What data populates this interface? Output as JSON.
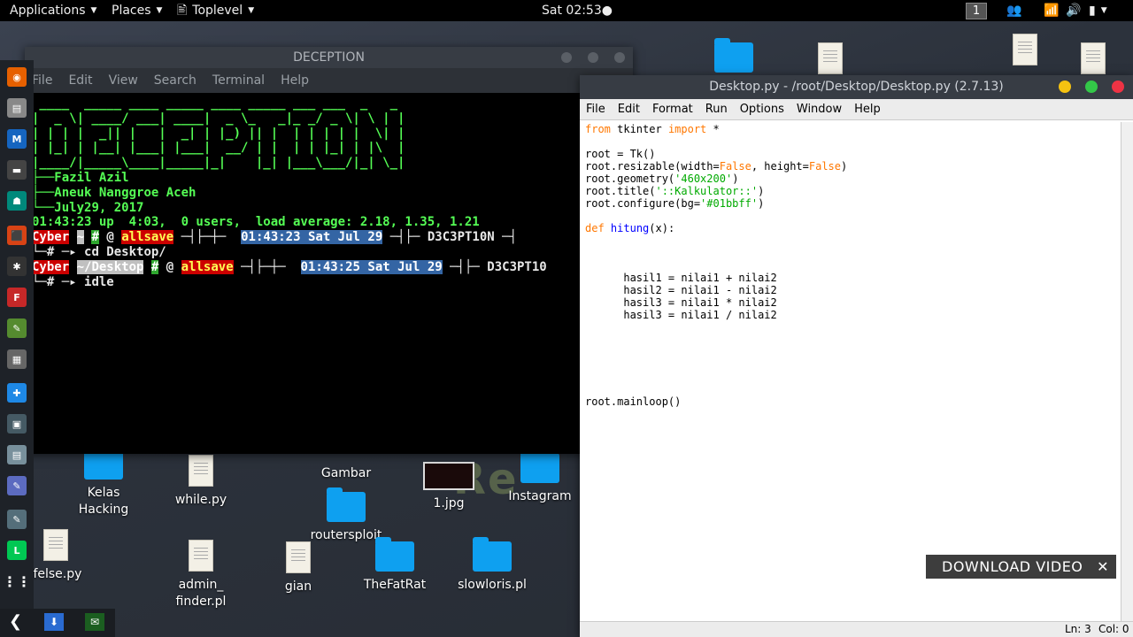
{
  "topbar": {
    "applications": "Applications",
    "places": "Places",
    "toplevel": "Toplevel",
    "clock": "Sat 02:53●",
    "workspace": "1"
  },
  "desktop": {
    "bg_text": "Re",
    "icons": [
      {
        "label": "Kelas Hacking",
        "type": "folder"
      },
      {
        "label": "while.py",
        "type": "file"
      },
      {
        "label": "Gambar",
        "type": "folder"
      },
      {
        "label": "1.jpg",
        "type": "image"
      },
      {
        "label": "Instagram",
        "type": "folder"
      },
      {
        "label": "routersploit",
        "type": "folder"
      },
      {
        "label": "ifelse.py",
        "type": "file"
      },
      {
        "label": "admin_\nfinder.pl",
        "type": "file"
      },
      {
        "label": "gian",
        "type": "file"
      },
      {
        "label": "TheFatRat",
        "type": "folder"
      },
      {
        "label": "slowloris.pl",
        "type": "folder"
      }
    ]
  },
  "terminal": {
    "title": "DECEPTION",
    "menu": [
      "File",
      "Edit",
      "View",
      "Search",
      "Terminal",
      "Help"
    ],
    "banner": [
      " ____  _____ ____ _____ ____ _____ ___ ___  _   _ ",
      "|  _ \\| ____/ ___| ____|  _ \\_   _|_ _/ _ \\| \\ | |",
      "| | | |  _|| |   |  _| | |_) || |  | | | | |  \\| |",
      "| |_| | |__| |___| |___|  __/ | |  | | |_| | |\\  |",
      "|____/|_____\\____|_____|_|    |_| |___\\___/|_| \\_|"
    ],
    "info_1": "Fazil Azil",
    "info_2": "Aneuk Nanggroe Aceh",
    "info_3": "July29, 2017",
    "uptime": "01:43:23 up  4:03,  0 users,  load average: 2.18, 1.35, 1.21",
    "prompt1": {
      "user": "Cyber",
      "dir": "~",
      "hash": "#",
      "at": "@",
      "host": "allsave",
      "time": "01:43:23 Sat Jul 29",
      "tag": "D3C3PT10N",
      "cmd": "cd Desktop/"
    },
    "prompt2": {
      "user": "Cyber",
      "dir": "~/Desktop",
      "hash": "#",
      "at": "@",
      "host": "allsave",
      "time": "01:43:25 Sat Jul 29",
      "tag": "D3C3PT10",
      "cmd": "idle"
    }
  },
  "idle": {
    "title": "Desktop.py - /root/Desktop/Desktop.py (2.7.13)",
    "menu": [
      "File",
      "Edit",
      "Format",
      "Run",
      "Options",
      "Window",
      "Help"
    ],
    "status_line": "Ln: 3",
    "status_col": "Col: 0"
  },
  "overlay": {
    "download_video": "DOWNLOAD VIDEO",
    "close": "✕"
  },
  "colors": {
    "folder": "#0ea0f0",
    "terminal_green": "#55ff55",
    "keyword": "#ff7700",
    "string": "#00aa00",
    "def_name": "#0000ff"
  }
}
